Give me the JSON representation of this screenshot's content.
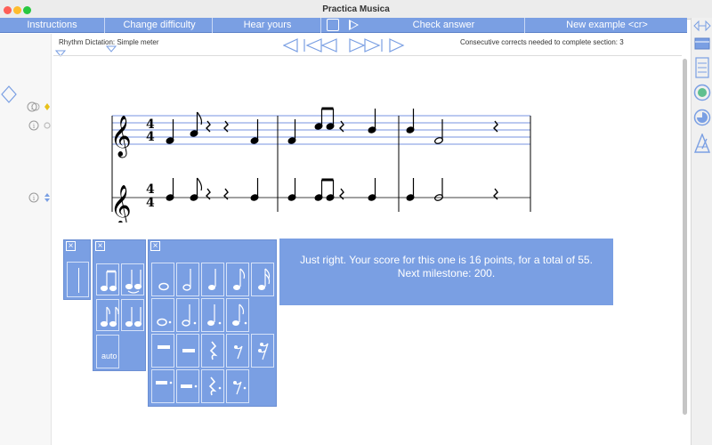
{
  "window": {
    "title": "Practica Musica"
  },
  "toolbar": {
    "instructions": "Instructions",
    "change_difficulty": "Change difficulty",
    "hear_yours": "Hear yours",
    "check_answer": "Check answer",
    "new_example": "New example <cr>"
  },
  "header": {
    "exercise_label": "Rhythm Dictation: Simple meter",
    "consecutive_label": "Consecutive corrects needed to complete section: 3"
  },
  "score": {
    "time_signature": {
      "top": "4",
      "bottom": "4"
    }
  },
  "palettes": {
    "auto_label": "auto"
  },
  "feedback": {
    "message": "Just right. Your score for this one is 16 points, for a total of 55. Next milestone: 200."
  },
  "colors": {
    "accent": "#7a9fe3",
    "staff_line": "#4a6fd6"
  }
}
